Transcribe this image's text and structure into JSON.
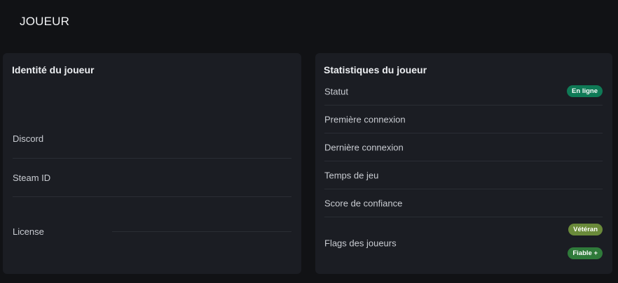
{
  "page": {
    "title": "JOUEUR"
  },
  "identity": {
    "title": "Identité du joueur",
    "fields": {
      "discord": "Discord",
      "steam_id": "Steam ID",
      "license": "License"
    }
  },
  "stats": {
    "title": "Statistiques du joueur",
    "rows": {
      "status": {
        "label": "Statut",
        "badge": "En ligne"
      },
      "first_login": {
        "label": "Première connexion"
      },
      "last_login": {
        "label": "Dernière connexion"
      },
      "playtime": {
        "label": "Temps de jeu"
      },
      "trust_score": {
        "label": "Score de confiance"
      },
      "flags": {
        "label": "Flags des joueurs",
        "badges": [
          "Vétéran",
          "Fiable +"
        ]
      }
    }
  },
  "colors": {
    "online_badge": "#0f7a56",
    "veteran_badge": "#6a8a3a",
    "trusted_badge": "#2f7a3a"
  }
}
